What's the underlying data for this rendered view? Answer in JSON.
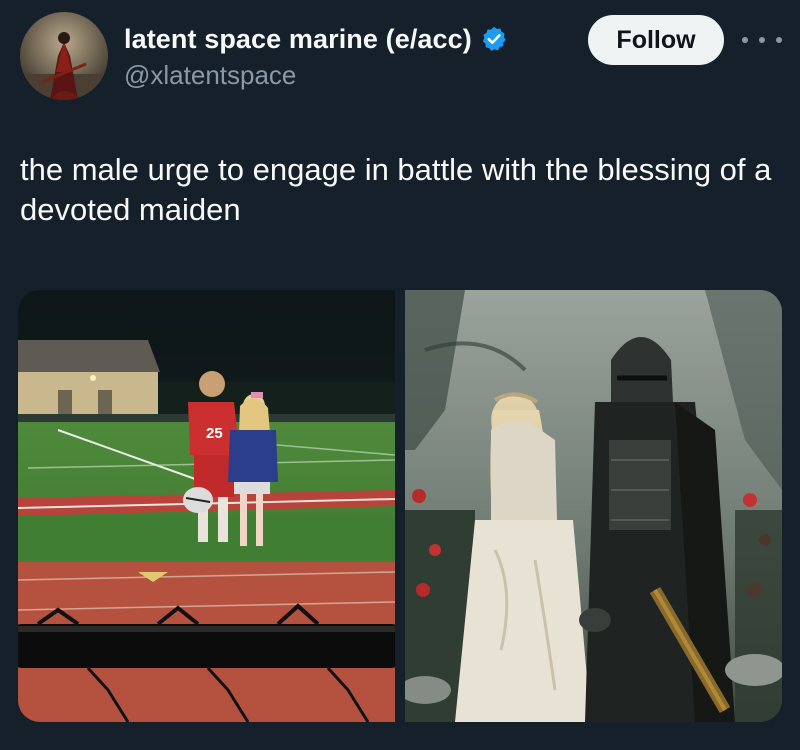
{
  "user": {
    "display_name": "latent space marine (e/acc)",
    "handle": "@xlatentspace",
    "verified": true,
    "avatar_icon": "avatar-warrior-image"
  },
  "actions": {
    "follow_label": "Follow",
    "more_icon": "more-dots-icon"
  },
  "tweet": {
    "text": "the male urge to engage in battle with the blessing of a devoted maiden"
  },
  "media": [
    {
      "name": "football-field-photo",
      "jersey_number": "25"
    },
    {
      "name": "knight-maiden-painting"
    }
  ],
  "colors": {
    "background": "#15202b",
    "text": "#f7f9f9",
    "secondary_text": "#8b98a5",
    "verified_blue": "#1d9bf0",
    "follow_bg": "#eff3f4"
  }
}
